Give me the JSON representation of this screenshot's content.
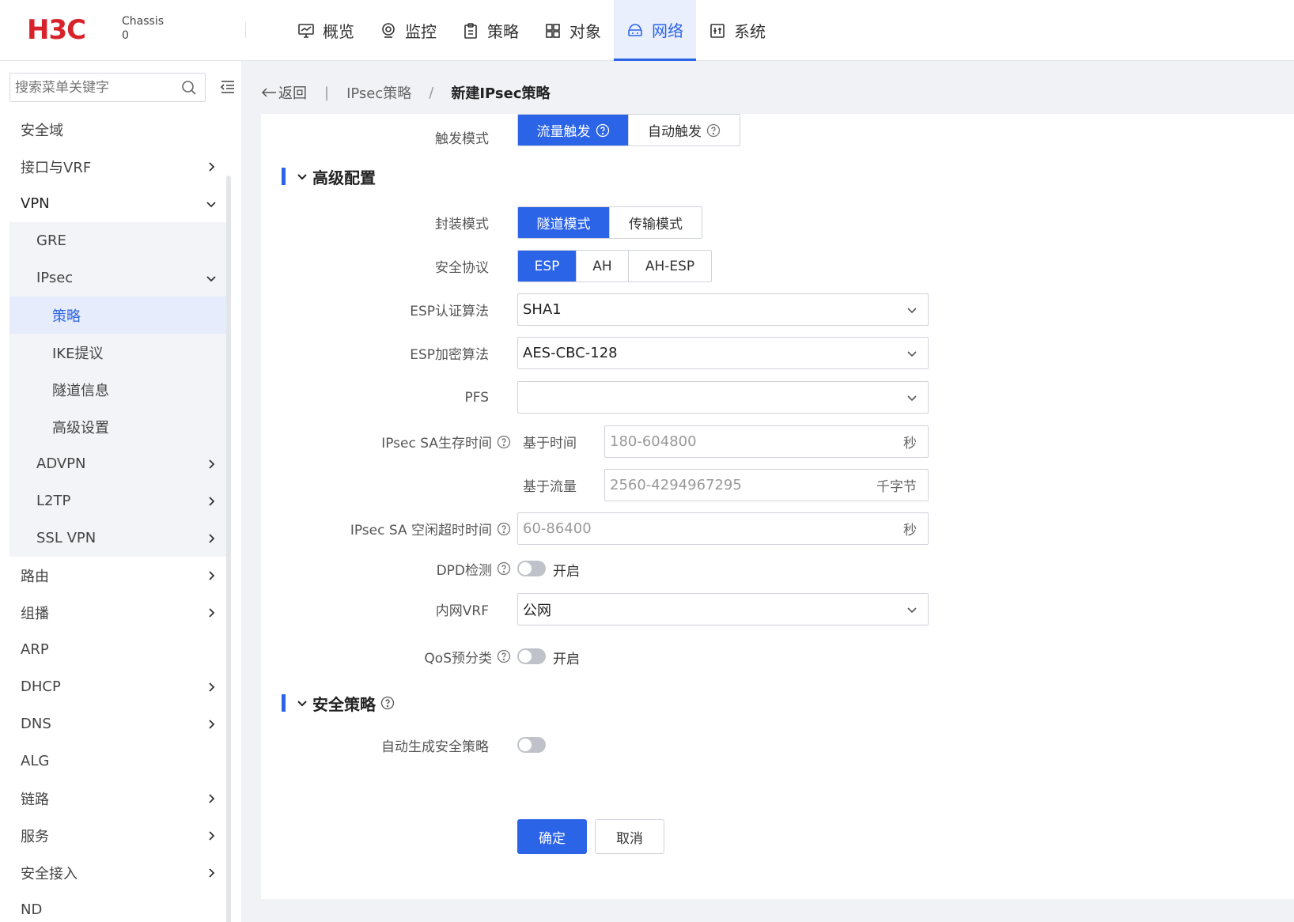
{
  "header": {
    "product": "Chassis",
    "chassis_no": "0",
    "nav": [
      {
        "label": "概览",
        "icon": "monitor-chart-icon"
      },
      {
        "label": "监控",
        "icon": "location-pin-icon"
      },
      {
        "label": "策略",
        "icon": "clipboard-icon"
      },
      {
        "label": "对象",
        "icon": "grid-icon"
      },
      {
        "label": "网络",
        "icon": "network-icon",
        "active": true
      },
      {
        "label": "系统",
        "icon": "system-panel-icon"
      }
    ]
  },
  "sidebar": {
    "search_placeholder": "搜索菜单关键字",
    "items": [
      {
        "label": "安全域"
      },
      {
        "label": "接口与VRF"
      },
      {
        "label": "VPN"
      },
      {
        "label": "GRE"
      },
      {
        "label": "IPsec"
      },
      {
        "label": "策略"
      },
      {
        "label": "IKE提议"
      },
      {
        "label": "隧道信息"
      },
      {
        "label": "高级设置"
      },
      {
        "label": "ADVPN"
      },
      {
        "label": "L2TP"
      },
      {
        "label": "SSL VPN"
      },
      {
        "label": "路由"
      },
      {
        "label": "组播"
      },
      {
        "label": "ARP"
      },
      {
        "label": "DHCP"
      },
      {
        "label": "DNS"
      },
      {
        "label": "ALG"
      },
      {
        "label": "链路"
      },
      {
        "label": "服务"
      },
      {
        "label": "安全接入"
      },
      {
        "label": "ND"
      }
    ]
  },
  "breadcrumb": {
    "back": "返回",
    "parent": "IPsec策略",
    "current": "新建IPsec策略"
  },
  "form": {
    "trigger_mode": {
      "label": "触发模式",
      "options": [
        "流量触发",
        "自动触发"
      ],
      "selected": "流量触发"
    },
    "advanced_title": "高级配置",
    "encap_mode": {
      "label": "封装模式",
      "options": [
        "隧道模式",
        "传输模式"
      ],
      "selected": "隧道模式"
    },
    "security_protocol": {
      "label": "安全协议",
      "options": [
        "ESP",
        "AH",
        "AH-ESP"
      ],
      "selected": "ESP"
    },
    "esp_auth": {
      "label": "ESP认证算法",
      "value": "SHA1"
    },
    "esp_encrypt": {
      "label": "ESP加密算法",
      "value": "AES-CBC-128"
    },
    "pfs": {
      "label": "PFS",
      "value": ""
    },
    "sa_lifetime": {
      "label": "IPsec SA生存时间",
      "time_label": "基于时间",
      "time_placeholder": "180-604800",
      "time_unit": "秒",
      "traffic_label": "基于流量",
      "traffic_placeholder": "2560-4294967295",
      "traffic_unit": "千字节"
    },
    "sa_idle_timeout": {
      "label": "IPsec SA 空闲超时时间",
      "placeholder": "60-86400",
      "unit": "秒"
    },
    "dpd": {
      "label": "DPD检测",
      "toggle_text": "开启"
    },
    "inner_vrf": {
      "label": "内网VRF",
      "value": "公网"
    },
    "qos": {
      "label": "QoS预分类",
      "toggle_text": "开启"
    },
    "security_policy_title": "安全策略",
    "auto_policy": {
      "label": "自动生成安全策略"
    },
    "ok_button": "确定",
    "cancel_button": "取消"
  },
  "colors": {
    "accent": "#2c64e8",
    "brand_red": "#d7242c"
  }
}
